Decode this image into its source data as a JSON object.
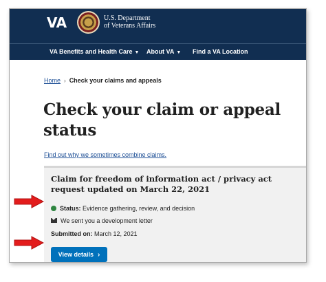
{
  "header": {
    "logo_text": "VA",
    "dept_line1": "U.S. Department",
    "dept_line2": "of Veterans Affairs",
    "nav": [
      {
        "label": "VA Benefits and Health Care",
        "chevron": true
      },
      {
        "label": "About VA",
        "chevron": true
      },
      {
        "label": "Find a VA Location",
        "chevron": false
      }
    ]
  },
  "breadcrumb": {
    "home": "Home",
    "separator": "›",
    "current": "Check your claims and appeals"
  },
  "page": {
    "title": "Check your claim or appeal status",
    "combine_link": "Find out why we sometimes combine claims."
  },
  "claim": {
    "title": "Claim for freedom of information act / privacy act request updated on March 22, 2021",
    "status_label": "Status:",
    "status_value": "Evidence gathering, review, and decision",
    "status_color": "#2e8540",
    "letter_text": "We sent you a development letter",
    "submitted_label": "Submitted on:",
    "submitted_value": "March 12, 2021",
    "button_label": "View details"
  },
  "colors": {
    "header_bg": "#112e51",
    "link": "#1c4e95",
    "button_bg": "#0071bb",
    "arrow": "#e31c1c"
  }
}
